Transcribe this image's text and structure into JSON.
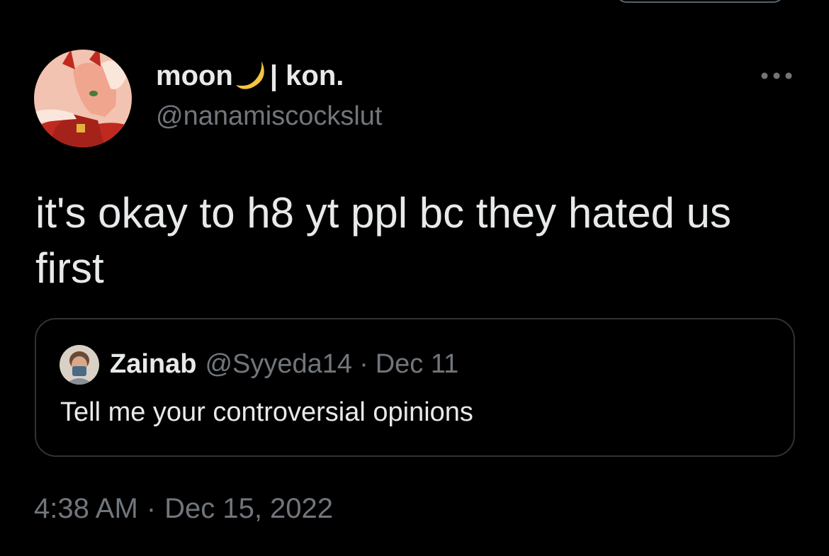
{
  "tweet": {
    "display_name": "moon",
    "display_name_suffix": "| kon.",
    "handle": "@nanamiscockslut",
    "text": "it's okay to h8 yt ppl bc they hated us first",
    "time": "4:38 AM",
    "separator": "·",
    "date": "Dec 15, 2022",
    "icons": {
      "name_emoji": "crescent-moon-icon",
      "more": "more-horizontal-icon"
    }
  },
  "quoted_tweet": {
    "name": "Zainab",
    "handle": "@Syyeda14",
    "separator": "·",
    "date": "Dec 11",
    "text": "Tell me your controversial opinions"
  },
  "colors": {
    "background": "#000000",
    "primary_text": "#e7e9ea",
    "secondary_text": "#71767b",
    "border": "#2f3336",
    "moon": "#f4c542"
  }
}
